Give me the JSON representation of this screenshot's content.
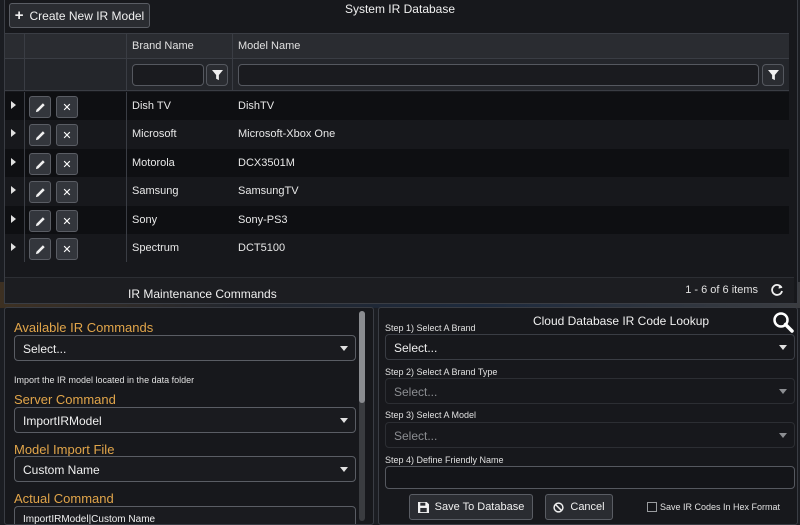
{
  "toolbar": {
    "create_label": "Create New IR Model",
    "grid_title": "System IR Database"
  },
  "grid": {
    "columns": [
      "Brand Name",
      "Model Name"
    ],
    "rows": [
      {
        "brand": "Dish TV",
        "model": "DishTV"
      },
      {
        "brand": "Microsoft",
        "model": "Microsoft-Xbox One"
      },
      {
        "brand": "Motorola",
        "model": "DCX3501M"
      },
      {
        "brand": "Samsung",
        "model": "SamsungTV"
      },
      {
        "brand": "Sony",
        "model": "Sony-PS3"
      },
      {
        "brand": "Spectrum",
        "model": "DCT5100"
      }
    ],
    "pager": "1 - 6 of 6 items"
  },
  "maintenance": {
    "title": "IR Maintenance Commands",
    "available_label": "Available IR Commands",
    "available_value": "Select...",
    "import_note": "Import the IR model located in the data folder",
    "server_label": "Server Command",
    "server_value": "ImportIRModel",
    "import_file_label": "Model Import File",
    "import_file_value": "Custom Name",
    "actual_label": "Actual Command",
    "actual_value": "ImportIRModel|Custom Name"
  },
  "cloud": {
    "title": "Cloud Database IR Code Lookup",
    "step1_label": "Step 1) Select A Brand",
    "step1_value": "Select...",
    "step2_label": "Step 2) Select A Brand Type",
    "step2_value": "Select...",
    "step3_label": "Step 3) Select A Model",
    "step3_value": "Select...",
    "step4_label": "Step 4) Define Friendly Name",
    "save_label": "Save To Database",
    "cancel_label": "Cancel",
    "hex_label": "Save IR Codes In Hex Format"
  },
  "icons": {
    "create": "plus-icon",
    "filter": "filter-icon",
    "edit": "pencil-icon",
    "delete": "close-icon",
    "expand": "caret-right-icon",
    "refresh": "refresh-icon",
    "search": "magnifier-icon",
    "save": "floppy-icon",
    "cancel": "ban-icon"
  },
  "colors": {
    "accent_label": "#e1a54a",
    "panel_bg": "#17181c"
  }
}
